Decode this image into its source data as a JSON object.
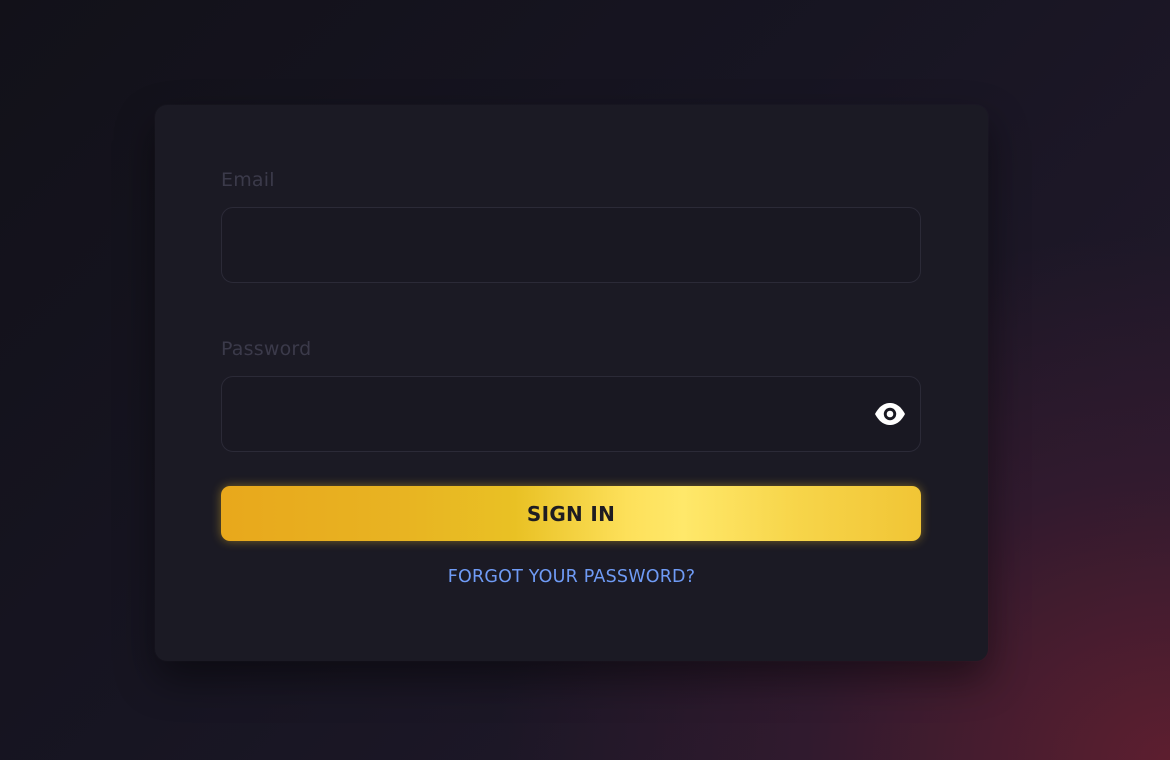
{
  "login_form": {
    "email": {
      "label": "Email",
      "value": "",
      "placeholder": ""
    },
    "password": {
      "label": "Password",
      "value": "",
      "placeholder": "",
      "toggle_icon": "eye-icon"
    },
    "sign_in_label": "SIGN IN",
    "forgot_password_label": "FORGOT YOUR PASSWORD?"
  },
  "colors": {
    "accent": "#f2c12e",
    "link": "#6f9bf5",
    "card": "#1b1a24",
    "label": "#3b3a4a"
  }
}
